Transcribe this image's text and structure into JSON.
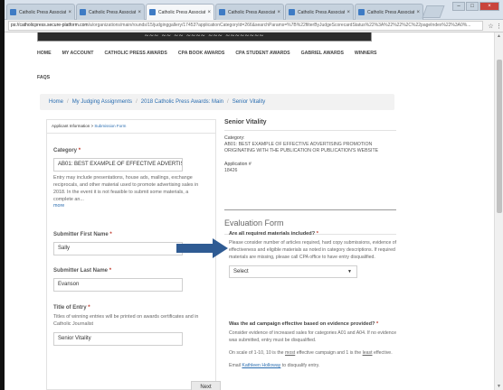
{
  "browser": {
    "tabs": [
      {
        "label": "Catholic Press Associati",
        "active": false
      },
      {
        "label": "Catholic Press Associati",
        "active": false
      },
      {
        "label": "Catholic Press Associati",
        "active": true
      },
      {
        "label": "Catholic Press Associati",
        "active": false
      },
      {
        "label": "Catholic Press Associati",
        "active": false
      },
      {
        "label": "Catholic Press Associati",
        "active": false
      }
    ],
    "url_host": "ps://catholicpress.secure-platform.com",
    "url_path": "/a/organizations/main/rounds/15/judginggallery/17453?applicationCategoryId=266&searchParams=%7B%22filterByJudgeScorecardStatus%22%3A%22%22%2C%22pageIndex%22%3A0%..."
  },
  "site": {
    "banner_text": "~~~ ~~ ~~ ~~~~ ~~~ ~~~~~~~~",
    "nav": [
      "HOME",
      "MY ACCOUNT",
      "CATHOLIC PRESS AWARDS",
      "CPA BOOK AWARDS",
      "CPA STUDENT AWARDS",
      "GABRIEL AWARDS",
      "WINNERS"
    ],
    "nav_faqs": "FAQS"
  },
  "breadcrumb": [
    "Home",
    "My Judging Assignments",
    "2018 Catholic Press Awards: Main",
    "Senior Vitality"
  ],
  "submission": {
    "head_label": "Applicant Information",
    "head_link": "Submission Form",
    "category_label": "Category",
    "category_value": "AB01: BEST EXAMPLE OF EFFECTIVE ADVERTISI",
    "category_help": "Entry may include presentations, house ads, mailings, exchange reciprocals, and other material used to promote advertising sales in 2018. In the event it is not feasible to submit some materials, a complete an...",
    "more_link": "more",
    "first_name_label": "Submitter First Name",
    "first_name_value": "Sally",
    "last_name_label": "Submitter Last Name",
    "last_name_value": "Evanson",
    "title_label": "Title of Entry",
    "title_help": "Titles of winning entries will be printed on awards certificates and in Catholic Journalist",
    "title_value": "Senior Vitality",
    "next_button": "Next"
  },
  "entry_info": {
    "title": "Senior Vitality",
    "category_key": "Category:",
    "category_value": "AB01: BEST EXAMPLE OF EFFECTIVE ADVERTISING PROMOTION ORIGINATING WITH THE PUBLICATION OR PUBLICATION'S WEBSITE",
    "app_key": "Application #",
    "app_value": "18426"
  },
  "evaluation": {
    "heading": "Evaluation Form",
    "q1_title": "Are all required materials included?",
    "q1_text": "Please consider number of articles required, hard copy submissions, evidence of effectiveness and eligible materials as noted in category descriptions. If required materials are missing, please call CPA office to have entry disqualified.",
    "q1_select": "Select",
    "q2_title": "Was the ad campaign effective based on evidence provided?",
    "q2_text": "Consider evidence of increased sales for categories A01 and A04. If no evidence was submitted, entry must be disqualified.",
    "q2_scale_a": "On scale of 1-10, 10 is the ",
    "q2_scale_most": "most",
    "q2_scale_b": " effective campaign and 1 is the ",
    "q2_scale_least": "least",
    "q2_scale_c": " effective.",
    "q2_email_a": "Email ",
    "q2_email_link": "Kathleen Holloway",
    "q2_email_b": " to disqualify entry."
  },
  "colors": {
    "accent_blue": "#2a6db0",
    "arrow": "#2f5b93",
    "required": "#c0392b"
  }
}
